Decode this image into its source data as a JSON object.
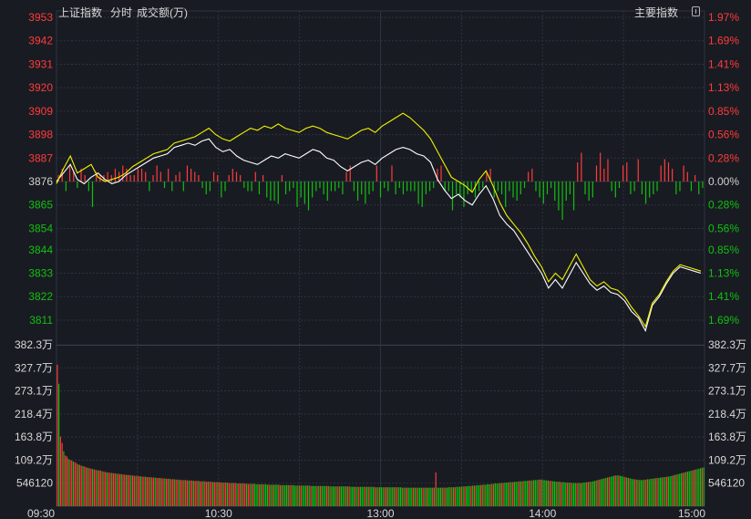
{
  "header": {
    "index_name": "上证指数",
    "view_mode": "分时",
    "volume_label": "成交额(万)",
    "main_index_label": "主要指数"
  },
  "colors": {
    "background": "#191b22",
    "up": "#ff3b3b",
    "down": "#10c010",
    "neutral": "#d0d0d0",
    "price_line": "#ffffff",
    "avg_line": "#f2f200",
    "grid": "#2e3340"
  },
  "chart_data": {
    "type": "line",
    "x_ticks": [
      "09:30",
      "10:30",
      "13:00",
      "14:00",
      "15:00"
    ],
    "price_axis": {
      "base": 3876,
      "ylim": [
        3802,
        3956
      ],
      "left_ticks": [
        3953,
        3942,
        3931,
        3920,
        3909,
        3898,
        3887,
        3876,
        3865,
        3854,
        3844,
        3833,
        3822,
        3811
      ],
      "right_ticks": [
        "1.97%",
        "1.69%",
        "1.41%",
        "1.13%",
        "0.85%",
        "0.56%",
        "0.28%",
        "0.00%",
        "0.28%",
        "0.56%",
        "0.85%",
        "1.13%",
        "1.41%",
        "1.69%"
      ]
    },
    "volume_axis": {
      "ylim": [
        0,
        382.3
      ],
      "left_ticks": [
        "382.3万",
        "327.7万",
        "273.1万",
        "218.4万",
        "163.8万",
        "109.2万",
        "546120"
      ],
      "right_ticks": [
        "382.3万",
        "327.7万",
        "273.1万",
        "218.4万",
        "163.8万",
        "109.2万",
        "546120"
      ],
      "tick_values": [
        382.3,
        327.7,
        273.1,
        218.4,
        163.8,
        109.2,
        54.6
      ]
    },
    "series": [
      {
        "key": "price",
        "color": "#ffffff",
        "points": [
          [
            0,
            3876
          ],
          [
            5,
            3880
          ],
          [
            10,
            3884
          ],
          [
            15,
            3877
          ],
          [
            20,
            3875
          ],
          [
            25,
            3878
          ],
          [
            30,
            3880
          ],
          [
            35,
            3877
          ],
          [
            40,
            3875
          ],
          [
            45,
            3876
          ],
          [
            50,
            3879
          ],
          [
            55,
            3881
          ],
          [
            60,
            3883
          ],
          [
            65,
            3885
          ],
          [
            70,
            3887
          ],
          [
            75,
            3888
          ],
          [
            80,
            3889
          ],
          [
            85,
            3892
          ],
          [
            90,
            3893
          ],
          [
            95,
            3894
          ],
          [
            100,
            3893
          ],
          [
            105,
            3895
          ],
          [
            110,
            3896
          ],
          [
            115,
            3892
          ],
          [
            120,
            3890
          ],
          [
            125,
            3891
          ],
          [
            130,
            3888
          ],
          [
            135,
            3886
          ],
          [
            140,
            3885
          ],
          [
            145,
            3884
          ],
          [
            150,
            3886
          ],
          [
            155,
            3888
          ],
          [
            160,
            3887
          ],
          [
            165,
            3889
          ],
          [
            170,
            3888
          ],
          [
            175,
            3887
          ],
          [
            180,
            3889
          ],
          [
            185,
            3891
          ],
          [
            190,
            3890
          ],
          [
            195,
            3887
          ],
          [
            200,
            3886
          ],
          [
            205,
            3883
          ],
          [
            210,
            3881
          ],
          [
            215,
            3883
          ],
          [
            220,
            3885
          ],
          [
            225,
            3886
          ],
          [
            230,
            3884
          ],
          [
            235,
            3887
          ],
          [
            240,
            3889
          ],
          [
            245,
            3891
          ],
          [
            250,
            3892
          ],
          [
            255,
            3891
          ],
          [
            260,
            3889
          ],
          [
            265,
            3888
          ],
          [
            270,
            3885
          ],
          [
            275,
            3877
          ],
          [
            280,
            3872
          ],
          [
            285,
            3868
          ],
          [
            290,
            3870
          ],
          [
            295,
            3867
          ],
          [
            300,
            3865
          ],
          [
            305,
            3870
          ],
          [
            310,
            3874
          ],
          [
            315,
            3868
          ],
          [
            320,
            3860
          ],
          [
            325,
            3856
          ],
          [
            330,
            3853
          ],
          [
            335,
            3848
          ],
          [
            340,
            3843
          ],
          [
            345,
            3838
          ],
          [
            350,
            3833
          ],
          [
            355,
            3826
          ],
          [
            360,
            3830
          ],
          [
            365,
            3826
          ],
          [
            370,
            3832
          ],
          [
            375,
            3838
          ],
          [
            380,
            3833
          ],
          [
            385,
            3828
          ],
          [
            390,
            3825
          ],
          [
            395,
            3827
          ],
          [
            400,
            3824
          ],
          [
            405,
            3823
          ],
          [
            410,
            3820
          ],
          [
            415,
            3815
          ],
          [
            420,
            3812
          ],
          [
            425,
            3806
          ],
          [
            430,
            3818
          ],
          [
            435,
            3822
          ],
          [
            440,
            3828
          ],
          [
            445,
            3833
          ],
          [
            450,
            3836
          ],
          [
            455,
            3835
          ],
          [
            460,
            3834
          ],
          [
            465,
            3833
          ]
        ]
      },
      {
        "key": "average",
        "color": "#f2f200",
        "points": [
          [
            0,
            3875
          ],
          [
            5,
            3882
          ],
          [
            10,
            3888
          ],
          [
            15,
            3880
          ],
          [
            20,
            3882
          ],
          [
            25,
            3884
          ],
          [
            30,
            3878
          ],
          [
            35,
            3876
          ],
          [
            40,
            3877
          ],
          [
            45,
            3878
          ],
          [
            50,
            3880
          ],
          [
            55,
            3883
          ],
          [
            60,
            3885
          ],
          [
            65,
            3887
          ],
          [
            70,
            3889
          ],
          [
            75,
            3890
          ],
          [
            80,
            3891
          ],
          [
            85,
            3894
          ],
          [
            90,
            3895
          ],
          [
            95,
            3896
          ],
          [
            100,
            3897
          ],
          [
            105,
            3899
          ],
          [
            110,
            3901
          ],
          [
            115,
            3898
          ],
          [
            120,
            3896
          ],
          [
            125,
            3895
          ],
          [
            130,
            3897
          ],
          [
            135,
            3899
          ],
          [
            140,
            3901
          ],
          [
            145,
            3900
          ],
          [
            150,
            3902
          ],
          [
            155,
            3901
          ],
          [
            160,
            3903
          ],
          [
            165,
            3901
          ],
          [
            170,
            3900
          ],
          [
            175,
            3899
          ],
          [
            180,
            3901
          ],
          [
            185,
            3902
          ],
          [
            190,
            3901
          ],
          [
            195,
            3899
          ],
          [
            200,
            3898
          ],
          [
            205,
            3897
          ],
          [
            210,
            3896
          ],
          [
            215,
            3898
          ],
          [
            220,
            3900
          ],
          [
            225,
            3901
          ],
          [
            230,
            3899
          ],
          [
            235,
            3902
          ],
          [
            240,
            3904
          ],
          [
            245,
            3906
          ],
          [
            250,
            3908
          ],
          [
            255,
            3906
          ],
          [
            260,
            3903
          ],
          [
            265,
            3900
          ],
          [
            270,
            3896
          ],
          [
            275,
            3890
          ],
          [
            280,
            3884
          ],
          [
            285,
            3878
          ],
          [
            290,
            3876
          ],
          [
            295,
            3874
          ],
          [
            300,
            3871
          ],
          [
            305,
            3877
          ],
          [
            310,
            3881
          ],
          [
            315,
            3874
          ],
          [
            320,
            3866
          ],
          [
            325,
            3860
          ],
          [
            330,
            3856
          ],
          [
            335,
            3852
          ],
          [
            340,
            3847
          ],
          [
            345,
            3841
          ],
          [
            350,
            3836
          ],
          [
            355,
            3829
          ],
          [
            360,
            3833
          ],
          [
            365,
            3830
          ],
          [
            370,
            3836
          ],
          [
            375,
            3842
          ],
          [
            380,
            3836
          ],
          [
            385,
            3830
          ],
          [
            390,
            3827
          ],
          [
            395,
            3829
          ],
          [
            400,
            3826
          ],
          [
            405,
            3825
          ],
          [
            410,
            3822
          ],
          [
            415,
            3817
          ],
          [
            420,
            3813
          ],
          [
            425,
            3808
          ],
          [
            430,
            3819
          ],
          [
            435,
            3823
          ],
          [
            440,
            3829
          ],
          [
            445,
            3834
          ],
          [
            450,
            3837
          ],
          [
            455,
            3836
          ],
          [
            460,
            3835
          ],
          [
            465,
            3834
          ]
        ]
      }
    ],
    "strength_bars": [
      2,
      4,
      -3,
      5,
      3,
      -2,
      4,
      2,
      -3,
      -8,
      3,
      2,
      2,
      3,
      2,
      4,
      3,
      5,
      4,
      2,
      2,
      4,
      4,
      3,
      -3,
      2,
      5,
      3,
      -2,
      4,
      -3,
      2,
      3,
      -3,
      5,
      4,
      3,
      2,
      -2,
      -4,
      -3,
      3,
      2,
      -5,
      -3,
      2,
      4,
      3,
      2,
      -2,
      -3,
      -3,
      3,
      -4,
      2,
      -5,
      -6,
      -6,
      -7,
      2,
      -4,
      -3,
      -2,
      -8,
      -5,
      -7,
      -9,
      -5,
      -3,
      -2,
      -4,
      -6,
      -3,
      -3,
      -2,
      -4,
      3,
      5,
      -3,
      -6,
      -4,
      -7,
      -4,
      -3,
      5,
      -5,
      -2,
      -3,
      5,
      -4,
      -2,
      -4,
      -3,
      -3,
      -3,
      -7,
      -8,
      -4,
      -3,
      -2,
      4,
      5,
      -3,
      -3,
      -9,
      -4,
      -5,
      -8,
      -4,
      -3,
      -5,
      -3,
      -2,
      3,
      4,
      -5,
      -3,
      -4,
      -8,
      -3,
      -5,
      -6,
      -4,
      -2,
      3,
      4,
      -3,
      -5,
      -7,
      -4,
      -2,
      -6,
      -9,
      -12,
      -6,
      -4,
      -9,
      6,
      9,
      -4,
      -6,
      -5,
      5,
      9,
      4,
      7,
      -3,
      -5,
      -2,
      5,
      6,
      -4,
      -3,
      7,
      -4,
      -7,
      -5,
      -4,
      -3,
      5,
      7,
      6,
      4,
      -4,
      -3,
      5,
      3,
      -3,
      2,
      -4,
      -2
    ],
    "volume_bars": [
      335,
      290,
      165,
      150,
      130,
      120,
      118,
      112,
      110,
      108,
      106,
      104,
      102,
      99,
      98,
      96,
      95,
      94,
      92,
      91,
      90,
      89,
      88,
      87,
      86,
      85,
      85,
      84,
      83,
      82,
      81,
      80,
      80,
      79,
      79,
      78,
      78,
      77,
      77,
      76,
      76,
      75,
      75,
      74,
      74,
      74,
      73,
      73,
      72,
      72,
      72,
      71,
      71,
      70,
      70,
      70,
      69,
      69,
      69,
      68,
      68,
      68,
      67,
      67,
      67,
      66,
      66,
      66,
      65,
      65,
      65,
      64,
      64,
      64,
      63,
      63,
      63,
      62,
      62,
      62,
      62,
      61,
      61,
      61,
      61,
      60,
      60,
      60,
      60,
      59,
      59,
      59,
      59,
      58,
      58,
      58,
      58,
      57,
      57,
      57,
      57,
      57,
      56,
      56,
      56,
      56,
      56,
      55,
      55,
      55,
      55,
      55,
      54,
      54,
      54,
      54,
      54,
      54,
      53,
      53,
      53,
      53,
      53,
      53,
      52,
      52,
      52,
      52,
      52,
      52,
      52,
      51,
      51,
      51,
      51,
      51,
      51,
      51,
      51,
      50,
      50,
      50,
      50,
      50,
      50,
      50,
      50,
      50,
      49,
      49,
      49,
      49,
      49,
      49,
      49,
      49,
      49,
      49,
      48,
      48,
      48,
      48,
      48,
      48,
      48,
      48,
      48,
      48,
      48,
      48,
      47,
      47,
      47,
      47,
      47,
      47,
      47,
      47,
      47,
      47,
      47,
      47,
      47,
      46,
      46,
      46,
      46,
      46,
      46,
      46,
      46,
      46,
      46,
      46,
      46,
      46,
      46,
      46,
      45,
      45,
      45,
      45,
      45,
      45,
      45,
      45,
      45,
      45,
      45,
      45,
      45,
      45,
      45,
      45,
      45,
      44,
      44,
      44,
      44,
      44,
      44,
      44,
      44,
      44,
      44,
      44,
      44,
      44,
      44,
      44,
      44,
      44,
      44,
      44,
      44,
      44,
      80,
      44,
      44,
      44,
      44,
      44,
      44,
      44,
      45,
      45,
      45,
      45,
      45,
      46,
      46,
      46,
      46,
      47,
      47,
      47,
      48,
      48,
      48,
      49,
      49,
      49,
      50,
      50,
      50,
      51,
      51,
      51,
      52,
      52,
      52,
      53,
      53,
      54,
      54,
      54,
      55,
      55,
      55,
      56,
      56,
      56,
      57,
      57,
      57,
      58,
      58,
      58,
      59,
      59,
      59,
      60,
      60,
      60,
      61,
      61,
      61,
      62,
      62,
      62,
      63,
      63,
      63,
      62,
      62,
      61,
      61,
      60,
      60,
      59,
      59,
      58,
      58,
      58,
      57,
      57,
      57,
      56,
      56,
      56,
      56,
      55,
      55,
      55,
      55,
      55,
      55,
      55,
      56,
      56,
      57,
      57,
      58,
      58,
      59,
      60,
      61,
      62,
      63,
      64,
      65,
      66,
      67,
      68,
      69,
      70,
      71,
      72,
      73,
      73,
      73,
      72,
      71,
      70,
      69,
      68,
      67,
      66,
      65,
      64,
      64,
      63,
      63,
      62,
      62,
      62,
      63,
      63,
      64,
      64,
      65,
      65,
      66,
      66,
      67,
      67,
      68,
      68,
      69,
      69,
      70,
      70,
      71,
      72,
      73,
      74,
      75,
      76,
      77,
      78,
      79,
      80,
      81,
      82,
      83,
      84,
      85,
      86,
      87,
      88,
      89,
      90,
      91,
      92
    ]
  }
}
